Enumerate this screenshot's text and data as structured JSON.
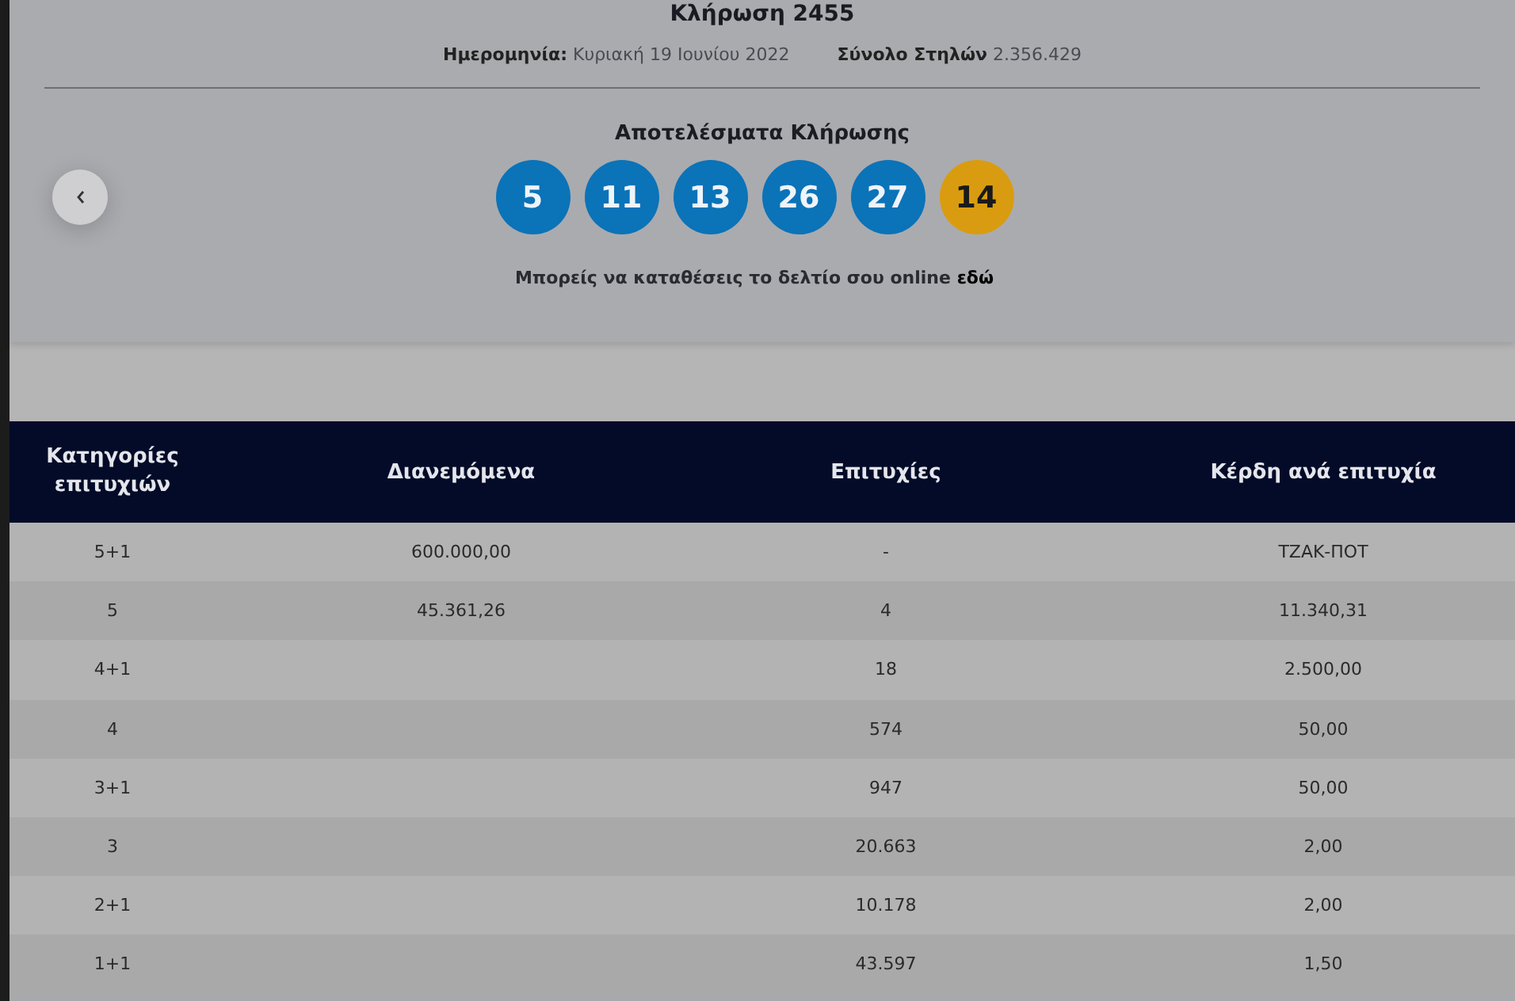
{
  "draw": {
    "title": "Κλήρωση 2455",
    "date_label": "Ημερομηνία:",
    "date": "Κυριακή 19 Ιουνίου 2022",
    "total_label": "Σύνολο Στηλών",
    "total": "2.356.429"
  },
  "results": {
    "title": "Αποτελέσματα Κλήρωσης",
    "balls": [
      {
        "number": "5",
        "kind": "main"
      },
      {
        "number": "11",
        "kind": "main"
      },
      {
        "number": "13",
        "kind": "main"
      },
      {
        "number": "26",
        "kind": "main"
      },
      {
        "number": "27",
        "kind": "main"
      },
      {
        "number": "14",
        "kind": "bonus"
      }
    ],
    "online_text": "Μπορείς να καταθέσεις το δελτίο σου online",
    "online_link": "εδώ"
  },
  "table": {
    "columns": [
      "Κατηγορίες επιτυχιών",
      "Διανεμόμενα",
      "Επιτυχίες",
      "Κέρδη ανά επιτυχία"
    ],
    "rows": [
      [
        "5+1",
        "600.000,00",
        "-",
        "ΤΖΑΚ-ΠΟΤ"
      ],
      [
        "5",
        "45.361,26",
        "4",
        "11.340,31"
      ],
      [
        "4+1",
        "",
        "18",
        "2.500,00"
      ],
      [
        "4",
        "",
        "574",
        "50,00"
      ],
      [
        "3+1",
        "",
        "947",
        "50,00"
      ],
      [
        "3",
        "",
        "20.663",
        "2,00"
      ],
      [
        "2+1",
        "",
        "10.178",
        "2,00"
      ],
      [
        "1+1",
        "",
        "43.597",
        "1,50"
      ]
    ]
  }
}
